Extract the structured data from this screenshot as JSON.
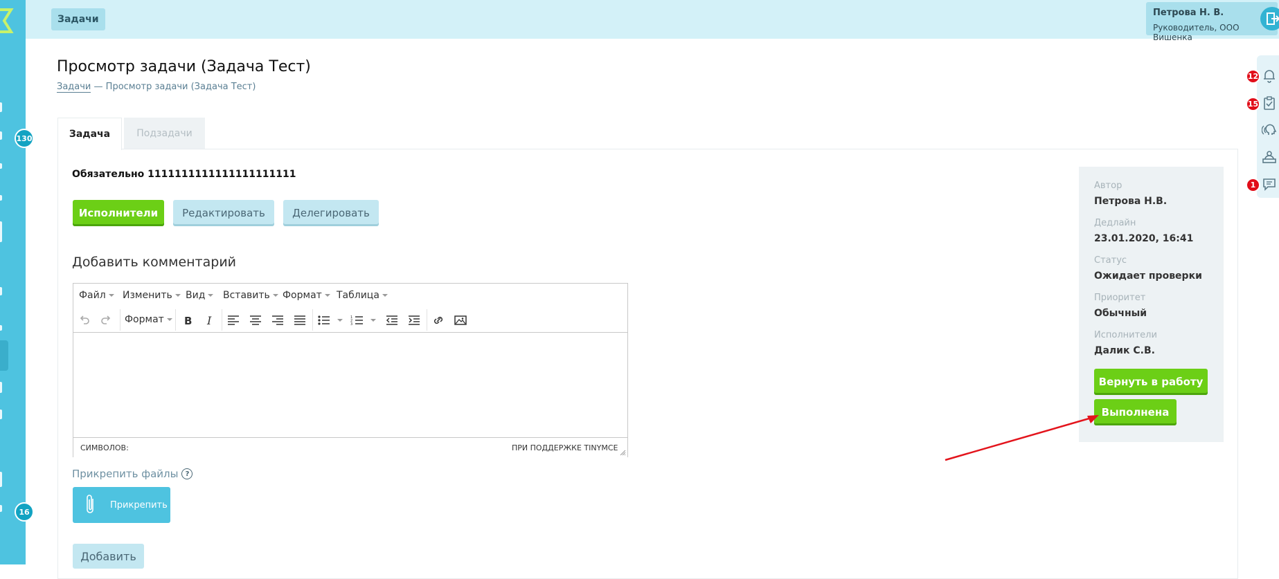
{
  "header": {
    "title": "Задачи",
    "user_name": "Петрова Н. В.",
    "user_role": "Руководитель, ООО Вишенка"
  },
  "sidebar": {
    "badges": [
      "130",
      "16"
    ]
  },
  "right_rail": {
    "items": [
      {
        "icon": "bell-icon",
        "badge": "12"
      },
      {
        "icon": "clipboard-check-icon",
        "badge": "15"
      },
      {
        "icon": "broadcast-head-icon",
        "badge": ""
      },
      {
        "icon": "reception-desk-icon",
        "badge": ""
      },
      {
        "icon": "chat-icon",
        "badge": "1"
      }
    ]
  },
  "page": {
    "title": "Просмотр задачи (Задача Тест)",
    "breadcrumb": {
      "link": "Задачи",
      "separator": "—",
      "current": "Просмотр задачи (Задача Тест)"
    }
  },
  "tabs": [
    {
      "label": "Задача",
      "active": true
    },
    {
      "label": "Подзадачи",
      "active": false
    }
  ],
  "task": {
    "description": "Обязательно 1111111111111111111111",
    "actions": {
      "executors": "Исполнители",
      "edit": "Редактировать",
      "delegate": "Делегировать"
    }
  },
  "comment": {
    "title": "Добавить комментарий",
    "menu": [
      "Файл",
      "Изменить",
      "Вид",
      "Вставить",
      "Формат",
      "Таблица"
    ],
    "toolbar_format": "Формат",
    "status_left": "СИМВОЛОВ:",
    "status_right": "ПРИ ПОДДЕРЖКЕ TINYMCE"
  },
  "attach": {
    "label": "Прикрепить файлы",
    "help": "?",
    "button": "Прикрепить"
  },
  "add_button": "Добавить",
  "info": {
    "author_label": "Автор",
    "author": "Петрова Н.В.",
    "deadline_label": "Дедлайн",
    "deadline": "23.01.2020, 16:41",
    "status_label": "Статус",
    "status": "Ожидает проверки",
    "priority_label": "Приоритет",
    "priority": "Обычный",
    "executors_label": "Исполнители",
    "executors": "Далик С.В.",
    "return_button": "Вернуть в работу",
    "done_button": "Выполнена"
  },
  "colors": {
    "sidebar": "#4ec3e0",
    "header": "#d3f1f8",
    "green": "#6ccf16",
    "badge_red": "#e10d19",
    "arrow": "#e3141c"
  }
}
